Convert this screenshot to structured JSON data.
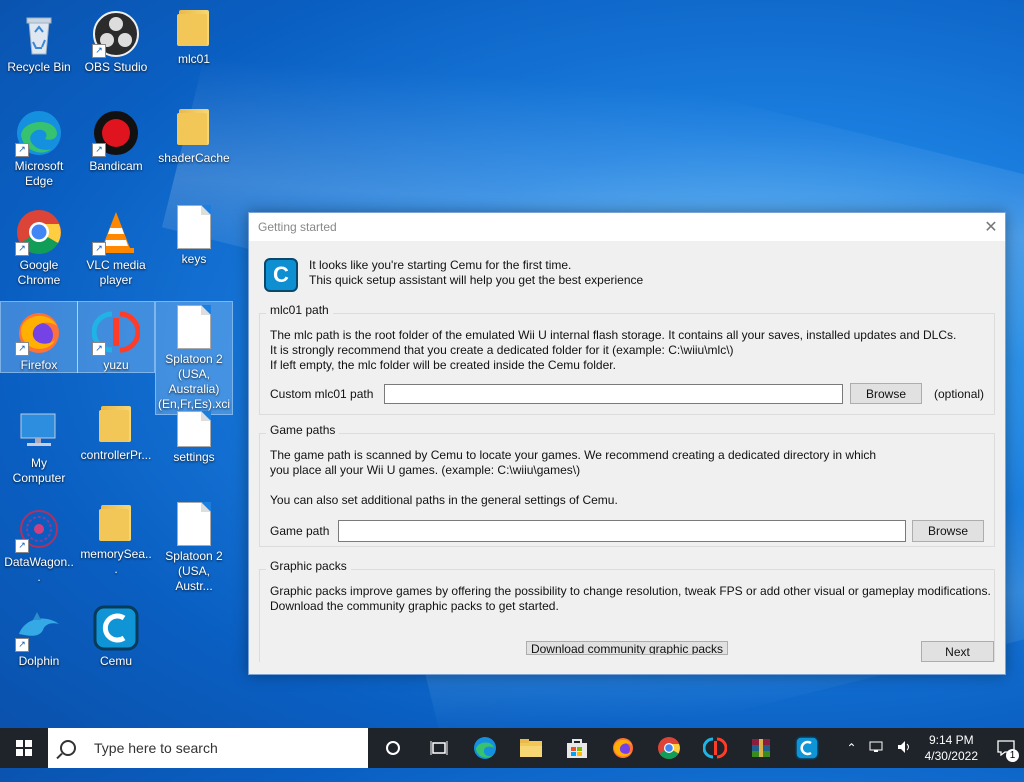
{
  "desktop": {
    "icons": [
      {
        "label": "Recycle Bin"
      },
      {
        "label": "OBS Studio"
      },
      {
        "label": "mlc01"
      },
      {
        "label": "Microsoft Edge"
      },
      {
        "label": "Bandicam"
      },
      {
        "label": "shaderCache"
      },
      {
        "label": "Google Chrome"
      },
      {
        "label": "VLC media player"
      },
      {
        "label": "keys"
      },
      {
        "label": "Firefox"
      },
      {
        "label": "yuzu"
      },
      {
        "label": "Splatoon 2 (USA, Australia) (En,Fr,Es).xci"
      },
      {
        "label": "My Computer"
      },
      {
        "label": "controllerPr..."
      },
      {
        "label": "settings"
      },
      {
        "label": "DataWagon..."
      },
      {
        "label": "memorySea..."
      },
      {
        "label": "Splatoon 2 (USA, Austr..."
      },
      {
        "label": "Dolphin"
      },
      {
        "label": "Cemu"
      }
    ]
  },
  "dialog": {
    "title": "Getting started",
    "close_glyph": "✕",
    "intro_line1": "It looks like you're starting Cemu for the first time.",
    "intro_line2": "This quick setup assistant will help you get the best experience",
    "mlc": {
      "title": "mlc01 path",
      "desc1": "The mlc path is the root folder of the emulated Wii U internal flash storage. It contains all your saves, installed updates and DLCs.",
      "desc2": "It is strongly recommend that you create a dedicated folder for it (example: C:\\wiiu\\mlc\\)",
      "desc3": "If left empty, the mlc folder will be created inside the Cemu folder.",
      "field_label": "Custom mlc01 path",
      "field_value": "",
      "browse_label": "Browse",
      "optional_label": "(optional)"
    },
    "game": {
      "title": "Game paths",
      "desc1": "The game path is scanned by Cemu to locate your games. We recommend creating a dedicated directory in which",
      "desc2": "you place all your Wii U games. (example: C:\\wiiu\\games\\)",
      "desc3": "You can also set additional paths in the general settings of Cemu.",
      "field_label": "Game path",
      "field_value": "",
      "browse_label": "Browse"
    },
    "graphic": {
      "title": "Graphic packs",
      "desc1": "Graphic packs improve games by offering the possibility to change resolution, tweak FPS or add other visual or gameplay modifications.",
      "desc2": "Download the community graphic packs to get started.",
      "download_label": "Download community graphic packs"
    },
    "next_label": "Next"
  },
  "taskbar": {
    "search_placeholder": "Type here to search",
    "time": "9:14 PM",
    "date": "4/30/2022",
    "notification_count": "1"
  }
}
